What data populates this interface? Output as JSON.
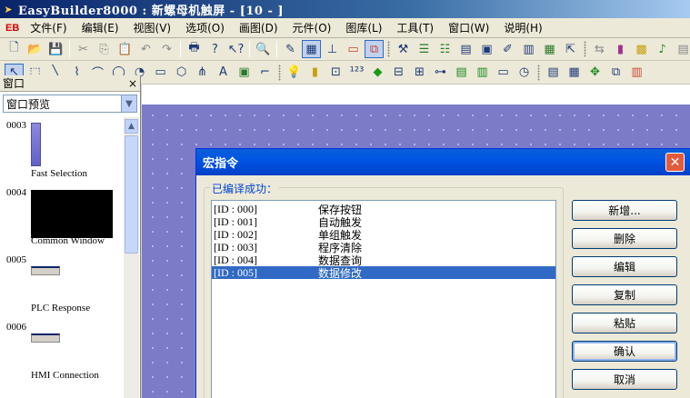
{
  "window": {
    "title": "EasyBuilder8000 : 新螺母机触屏 - [10 -  ]"
  },
  "menubar": {
    "logo": "EB",
    "items": [
      "文件(F)",
      "编辑(E)",
      "视图(V)",
      "选项(O)",
      "画图(D)",
      "元件(O)",
      "图库(L)",
      "工具(T)",
      "窗口(W)",
      "说明(H)"
    ]
  },
  "left_panel": {
    "title": "窗口",
    "close_glyph": "×",
    "dropdown_value": "窗口预览",
    "previews": [
      {
        "number": "0003",
        "caption": "Fast Selection"
      },
      {
        "number": "0004",
        "caption": "Common Window"
      },
      {
        "number": "0005",
        "caption": "PLC Response"
      },
      {
        "number": "0006",
        "caption": "HMI Connection"
      }
    ]
  },
  "dialog": {
    "title": "宏指令",
    "close_glyph": "✕",
    "status_label": "已编译成功：",
    "macros": [
      {
        "id": "[ID : 000]",
        "name": "保存按钮"
      },
      {
        "id": "[ID : 001]",
        "name": "自动触发"
      },
      {
        "id": "[ID : 002]",
        "name": "单组触发"
      },
      {
        "id": "[ID : 003]",
        "name": "程序清除"
      },
      {
        "id": "[ID : 004]",
        "name": "数据查询"
      },
      {
        "id": "[ID : 005]",
        "name": "数据修改"
      }
    ],
    "selected_index": 5,
    "buttons": {
      "new": "新增...",
      "delete": "删除",
      "edit": "编辑",
      "copy": "复制",
      "paste": "粘贴",
      "confirm": "确认",
      "cancel": "取消"
    }
  },
  "colors": {
    "selection": "#316ac5",
    "canvas": "#7b7bc8",
    "dialog_title": "#0055e5",
    "legend_text": "#0046d5"
  }
}
